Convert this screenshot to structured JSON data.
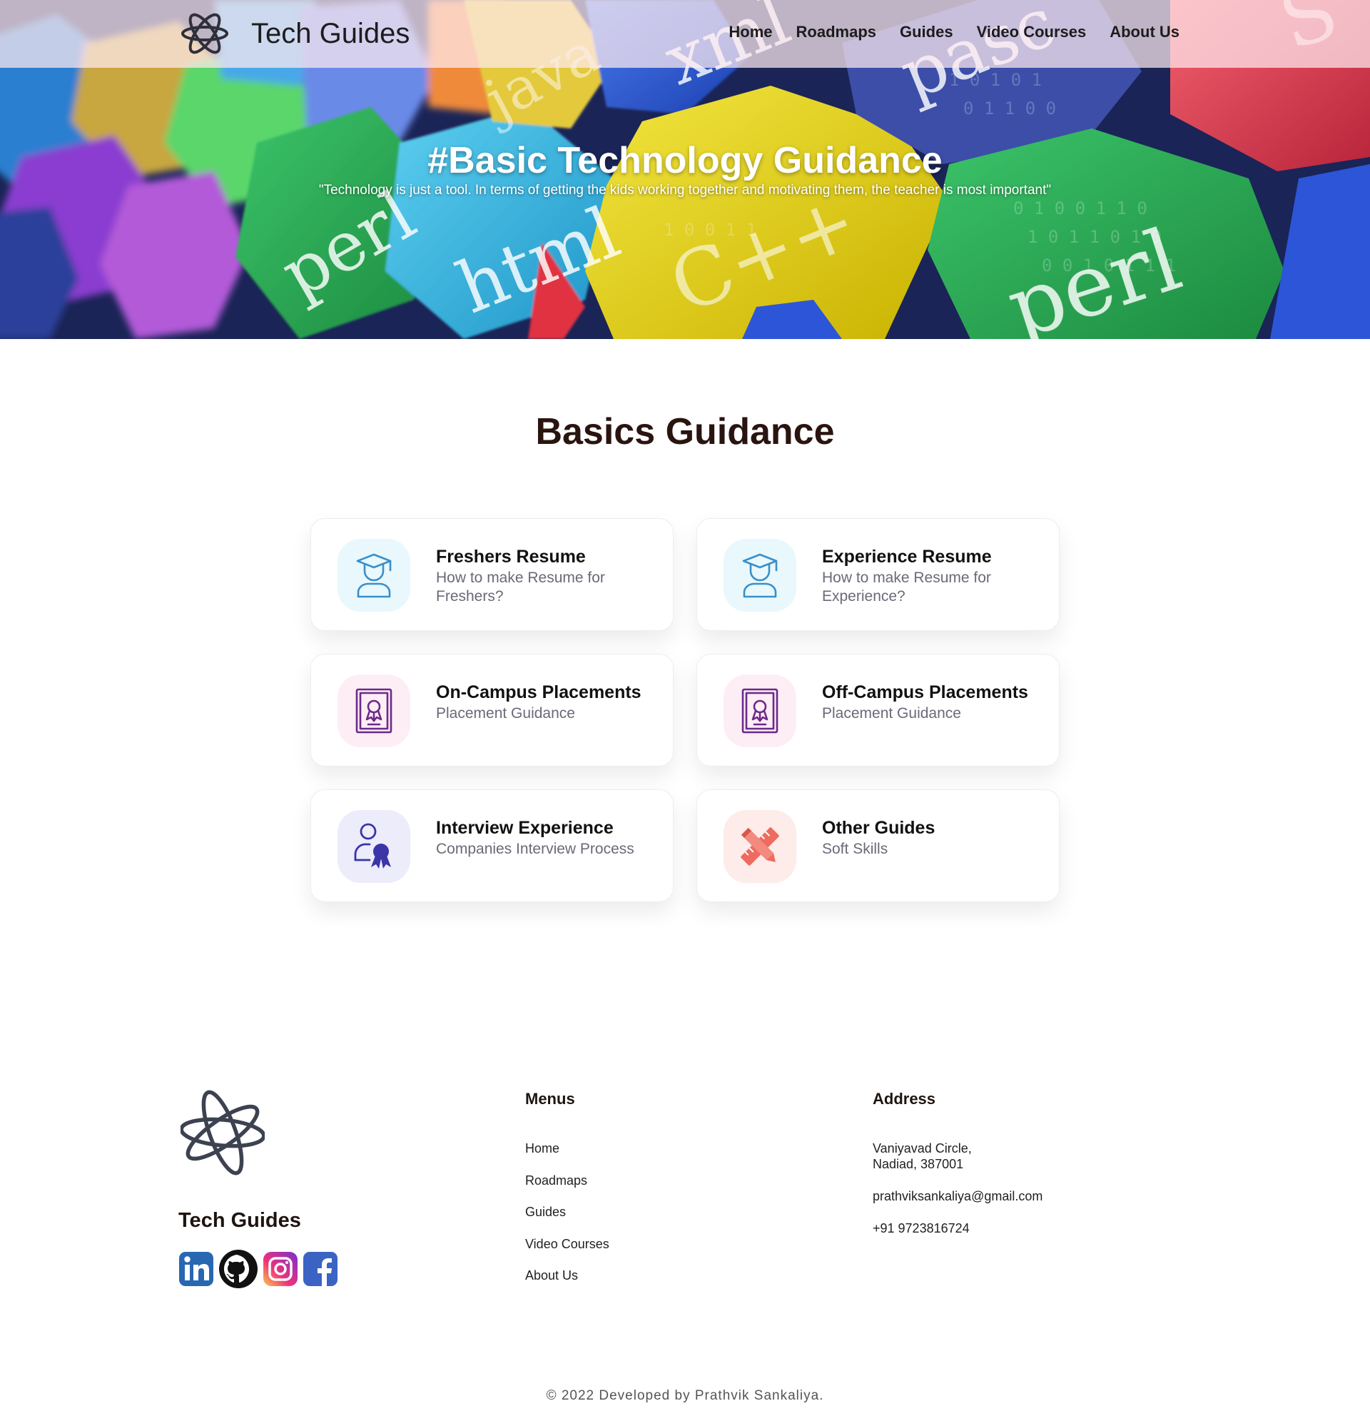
{
  "brand": {
    "name": "Tech Guides",
    "logo_icon": "atom-icon"
  },
  "nav": {
    "items": [
      "Home",
      "Roadmaps",
      "Guides",
      "Video Courses",
      "About Us"
    ]
  },
  "hero": {
    "title": "#Basic Technology Guidance",
    "quote": "\"Technology is just a tool. In terms of getting the kids working together and motivating them, the teacher is most important\"",
    "background_words": [
      "java",
      "xml",
      "pascal",
      "perl",
      "html",
      "C++",
      "perl"
    ]
  },
  "section": {
    "title": "Basics Guidance"
  },
  "cards": [
    {
      "title": "Freshers Resume",
      "subtitle": "How to make Resume for Freshers?",
      "icon": "graduate-icon",
      "icon_bg": "#e8f8fc",
      "icon_color": "#3a8fc9"
    },
    {
      "title": "Experience Resume",
      "subtitle": "How to make Resume for Experience?",
      "icon": "graduate-icon",
      "icon_bg": "#e8f8fc",
      "icon_color": "#3a8fc9"
    },
    {
      "title": "On-Campus Placements",
      "subtitle": "Placement Guidance",
      "icon": "certificate-icon",
      "icon_bg": "#fdeef5",
      "icon_color": "#6b2a8a"
    },
    {
      "title": "Off-Campus Placements",
      "subtitle": "Placement Guidance",
      "icon": "certificate-icon",
      "icon_bg": "#fdeef5",
      "icon_color": "#6b2a8a"
    },
    {
      "title": "Interview Experience",
      "subtitle": "Companies Interview Process",
      "icon": "user-award-icon",
      "icon_bg": "#ececfb",
      "icon_color": "#3a35a8"
    },
    {
      "title": "Other Guides",
      "subtitle": "Soft Skills",
      "icon": "pencil-ruler-icon",
      "icon_bg": "#fdece9",
      "icon_color": "#ef6b5f"
    }
  ],
  "footer": {
    "brand": "Tech Guides",
    "socials": [
      "linkedin-icon",
      "github-icon",
      "instagram-icon",
      "facebook-icon"
    ],
    "menus_heading": "Menus",
    "menus": [
      "Home",
      "Roadmaps",
      "Guides",
      "Video Courses",
      "About Us"
    ],
    "address_heading": "Address",
    "address_line1": "Vaniyavad Circle,",
    "address_line2": "Nadiad, 387001",
    "email": "prathviksankaliya@gmail.com",
    "phone": "+91 9723816724",
    "copyright": "© 2022 Developed by Prathvik Sankaliya."
  }
}
